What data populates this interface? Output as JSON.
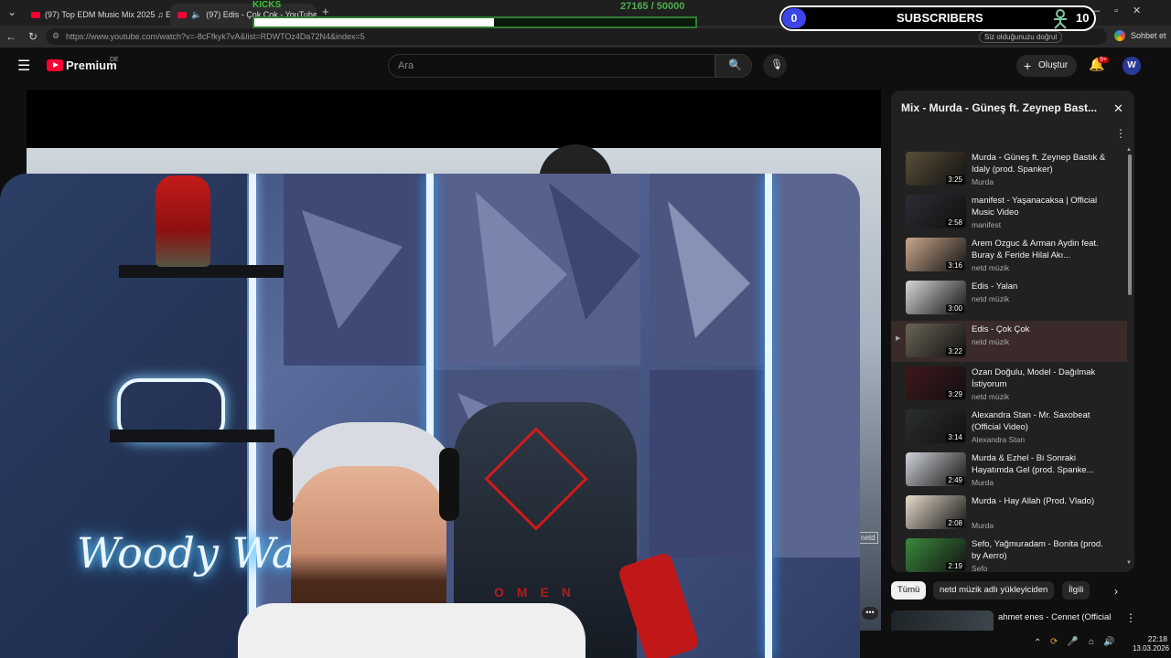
{
  "browser": {
    "tabs": [
      {
        "title": "(97) Top EDM Music Mix 2025 ♫ E"
      },
      {
        "title": "(97) Edis - Çok Çok - YouTube"
      }
    ],
    "url": "https://www.youtube.com/watch?v=-8cFfkyk7vA&list=RDWTOz4Da72N4&index=5",
    "translate_hint": "Siz olduğunuzu doğrul",
    "chat_label": "Sohbet et"
  },
  "overlay": {
    "kicks_label": "KICKS",
    "progress_text": "27165 / 50000",
    "progress_fraction": 0.543,
    "subs_count": "0",
    "subs_label": "SUBSCRIBERS",
    "subs_goal": "10"
  },
  "youtube": {
    "logo_text": "Premium",
    "logo_region": "DE",
    "search_placeholder": "Ara",
    "create_label": "Oluştur",
    "notif_count": "9+"
  },
  "player": {
    "neon_text": "Woody Walker",
    "chair_text": "OMEN"
  },
  "playlist": {
    "title": "Mix - Murda - Güneş ft. Zeynep Bast...",
    "items": [
      {
        "title": "Murda - Güneş ft. Zeynep Bastık & Idaly (prod. Spanker)",
        "channel": "Murda",
        "duration": "3:25"
      },
      {
        "title": "manifest - Yaşanacaksa | Official Music Video",
        "channel": "manifest",
        "duration": "2:58"
      },
      {
        "title": "Arem Ozguc & Arman Aydin feat. Buray & Feride Hilal Akı...",
        "channel": "netd müzik",
        "duration": "3:16"
      },
      {
        "title": "Edis - Yalan",
        "channel": "netd müzik",
        "duration": "3:00"
      },
      {
        "title": "Edis - Çok Çok",
        "channel": "netd müzik",
        "duration": "3:22"
      },
      {
        "title": "Ozan Doğulu, Model - Dağılmak İstiyorum",
        "channel": "netd müzik",
        "duration": "3:29"
      },
      {
        "title": "Alexandra Stan - Mr. Saxobeat (Official Video)",
        "channel": "Alexandra Stan",
        "duration": "3:14"
      },
      {
        "title": "Murda & Ezhel - Bi Sonraki Hayatımda Gel (prod. Spanke...",
        "channel": "Murda",
        "duration": "2:49"
      },
      {
        "title": "Murda - Hay Allah (Prod. Vlado)",
        "channel": "Murda",
        "duration": "2:08"
      },
      {
        "title": "Sefo, Yağmuradam - Bonita (prod. by Aerro)",
        "channel": "Sefo",
        "duration": "2:19"
      }
    ]
  },
  "chips": [
    "Tümü",
    "netd müzik adlı yükleyiciden",
    "İlgili"
  ],
  "next_video": {
    "title": "ahmet enes - Cennet (Official"
  },
  "taskbar": {
    "time": "22:18",
    "date": "13.03.2026"
  },
  "colors": {
    "accent": "#ff0033",
    "progress": "#4caf50"
  }
}
